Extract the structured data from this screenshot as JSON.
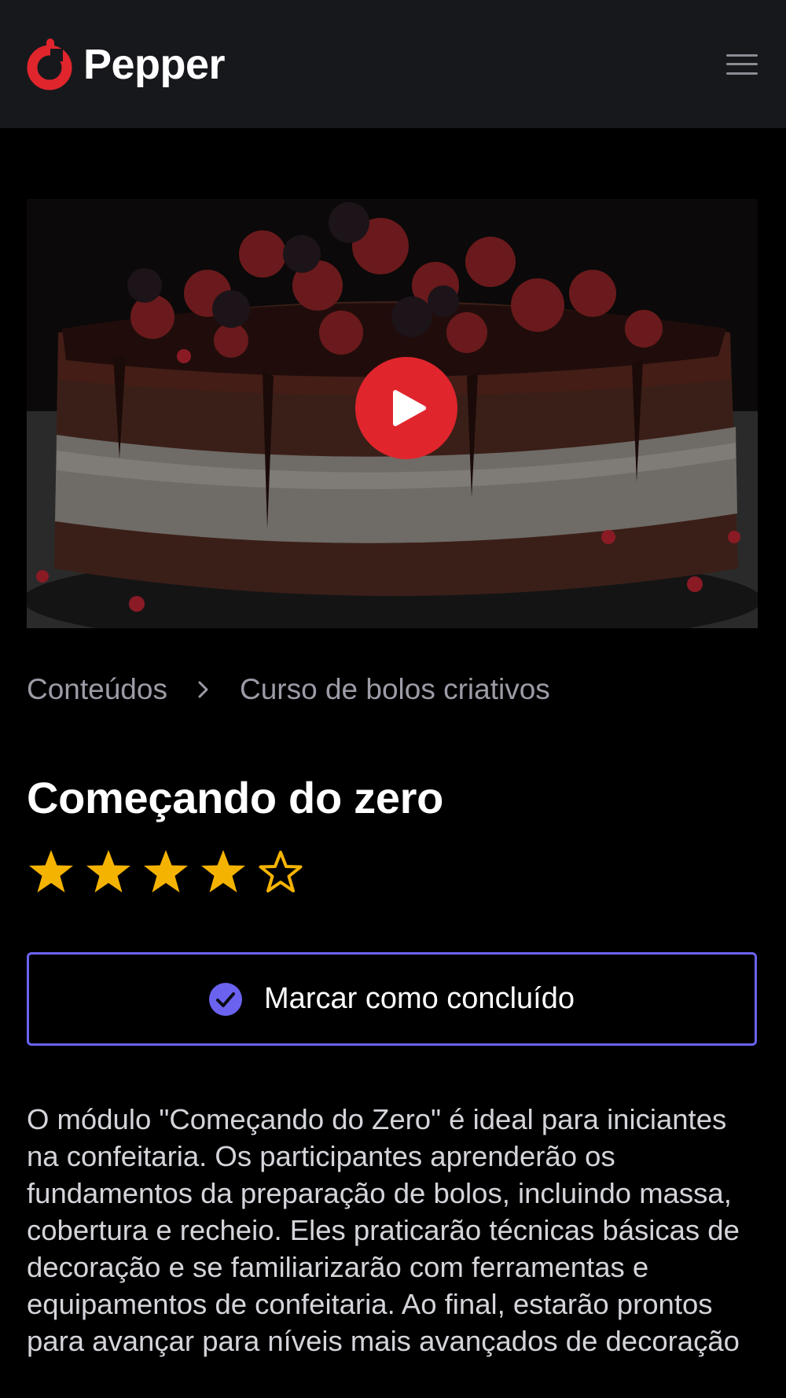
{
  "header": {
    "brand_name": "Pepper",
    "brand_icon": "pepper-logo-icon",
    "menu_icon": "hamburger-menu-icon"
  },
  "video": {
    "thumbnail": "chocolate layer cake with berries",
    "play_icon": "play-icon",
    "play_button_color": "#e0252d"
  },
  "breadcrumb": {
    "items": [
      "Conteúdos",
      "Curso de bolos criativos"
    ],
    "separator_icon": "chevron-right-icon"
  },
  "lesson": {
    "title": "Começando do zero",
    "rating": {
      "value": 4,
      "max": 5
    }
  },
  "complete_button": {
    "label": "Marcar como concluído",
    "icon": "check-circle-icon",
    "accent_color": "#6b63f0"
  },
  "description": "O módulo \"Começando do Zero\" é ideal para iniciantes na confeitaria. Os participantes aprenderão os fundamentos da preparação de bolos, incluindo massa, cobertura e recheio. Eles praticarão técnicas básicas de decoração e se familiarizarão com ferramentas e equipamentos de confeitaria. Ao final, estarão prontos para avançar para níveis mais avançados de decoração",
  "colors": {
    "background": "#000000",
    "header_background": "#17181c",
    "brand_red": "#e0252d",
    "star_gold": "#f5b301",
    "muted_text": "#9b9ca6"
  }
}
